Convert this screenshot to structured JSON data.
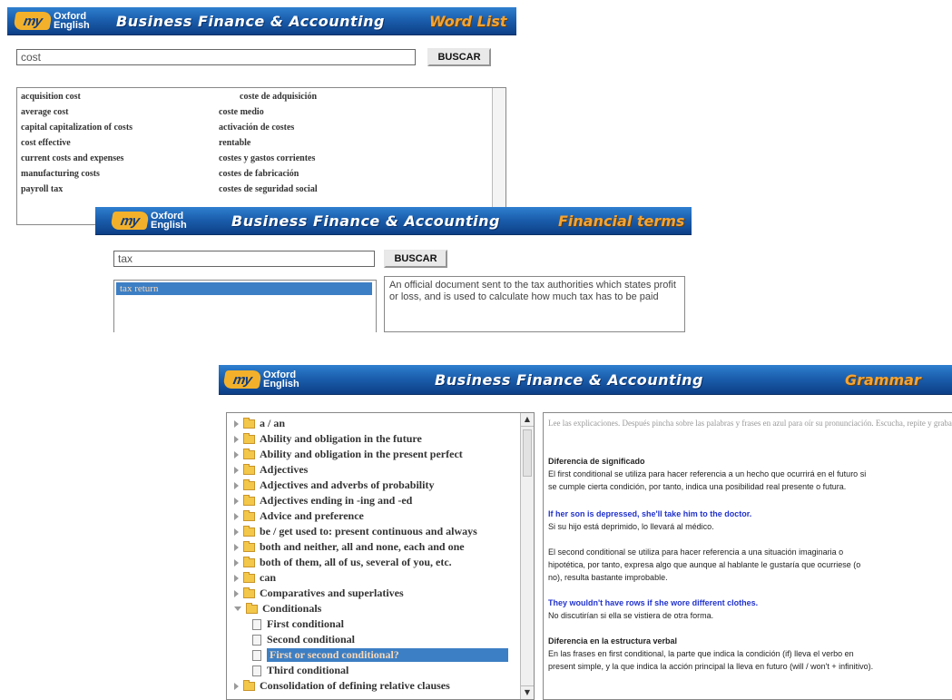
{
  "word_list": {
    "logo": {
      "mark": "my",
      "line1": "Oxford",
      "line2": "English"
    },
    "title": "Business Finance & Accounting",
    "section": "Word List",
    "search_value": "cost",
    "button": "BUSCAR",
    "rows": [
      {
        "en": "acquisition cost",
        "es": "coste de adquisición"
      },
      {
        "en": "average cost",
        "es": "coste medio"
      },
      {
        "en": "capital capitalization of costs",
        "es": "activación de costes"
      },
      {
        "en": "cost effective",
        "es": "rentable"
      },
      {
        "en": "current costs and expenses",
        "es": "costes y gastos corrientes"
      },
      {
        "en": "manufacturing costs",
        "es": "costes de fabricación"
      },
      {
        "en": "payroll tax",
        "es": "costes de seguridad social"
      }
    ]
  },
  "financial_terms": {
    "logo": {
      "mark": "my",
      "line1": "Oxford",
      "line2": "English"
    },
    "title": "Business Finance & Accounting",
    "section": "Financial terms",
    "search_value": "tax",
    "button": "BUSCAR",
    "selected_term": "tax return",
    "definition": "An official document sent to the tax authorities which states profit or loss, and is used to calculate how much tax has to be paid"
  },
  "grammar": {
    "logo": {
      "mark": "my",
      "line1": "Oxford",
      "line2": "English"
    },
    "title": "Business Finance & Accounting",
    "section": "Grammar",
    "tree": [
      {
        "label": "a / an"
      },
      {
        "label": "Ability and obligation in the future"
      },
      {
        "label": "Ability and obligation in the present perfect"
      },
      {
        "label": "Adjectives"
      },
      {
        "label": "Adjectives and adverbs of probability"
      },
      {
        "label": "Adjectives ending in -ing and -ed"
      },
      {
        "label": "Advice and preference"
      },
      {
        "label": "be / get used to: present continuous and always"
      },
      {
        "label": "both and neither, all and none, each and one"
      },
      {
        "label": "both of them, all of us, several of you, etc."
      },
      {
        "label": "can"
      },
      {
        "label": "Comparatives and superlatives"
      },
      {
        "label": "Conditionals"
      },
      {
        "label": "First conditional"
      },
      {
        "label": "Second conditional"
      },
      {
        "label": "First or second conditional?"
      },
      {
        "label": "Third conditional"
      },
      {
        "label": "Consolidation of defining relative clauses"
      }
    ],
    "content": {
      "intro": "Lee las explicaciones. Después pincha sobre las palabras y frases en azul para oír su pronunciación. Escucha, repite y graba tu voz.",
      "h1": "Diferencia de significado",
      "p1a": "El first conditional se utiliza para hacer referencia a un hecho que ocurrirá en el futuro si",
      "p1b": "se cumple cierta condición, por tanto, indica una posibilidad real presente o futura.",
      "ex1": "If her son is depressed, she'll take him to the doctor.",
      "tr1": "Si su hijo está deprimido, lo llevará al médico.",
      "p2a": "El second conditional se utiliza para hacer referencia a una situación imaginaria o",
      "p2b": "hipotética, por tanto, expresa algo que aunque al hablante le gustaría que ocurriese (o",
      "p2c": "no), resulta bastante improbable.",
      "ex2": "They wouldn't have rows if she wore different clothes.",
      "tr2": "No discutirían si ella se vistiera de otra forma.",
      "h2": "Diferencia en la estructura verbal",
      "p3a": "En las frases en first conditional, la parte que indica la condición (if) lleva el verbo en",
      "p3b": "present simple, y la que indica la acción principal la lleva en futuro (will / won't + infinitivo)."
    }
  }
}
